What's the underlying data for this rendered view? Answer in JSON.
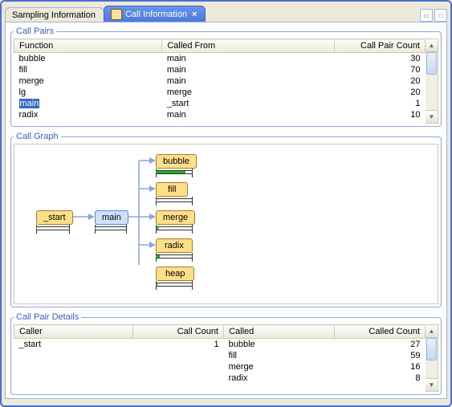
{
  "tabs": {
    "inactive": "Sampling Information",
    "active": "Call Information"
  },
  "call_pairs": {
    "title": "Call Pairs",
    "headers": {
      "function": "Function",
      "called_from": "Called From",
      "count": "Call Pair Count"
    },
    "rows": [
      {
        "fn": "bubble",
        "from": "main",
        "count": "30",
        "sel": false
      },
      {
        "fn": "fill",
        "from": "main",
        "count": "70",
        "sel": false
      },
      {
        "fn": "merge",
        "from": "main",
        "count": "20",
        "sel": false
      },
      {
        "fn": "lg",
        "from": "merge",
        "count": "20",
        "sel": false
      },
      {
        "fn": "main",
        "from": "_start",
        "count": "1",
        "sel": true
      },
      {
        "fn": "radix",
        "from": "main",
        "count": "10",
        "sel": false
      }
    ]
  },
  "call_graph": {
    "title": "Call Graph",
    "nodes": {
      "start": "_start",
      "main": "main",
      "bubble": "bubble",
      "fill": "fill",
      "merge": "merge",
      "radix": "radix",
      "heap": "heap"
    }
  },
  "call_pair_details": {
    "title": "Call Pair Details",
    "headers": {
      "caller": "Caller",
      "call_count": "Call Count",
      "called": "Called",
      "called_count": "Called Count"
    },
    "caller": "_start",
    "call_count": "1",
    "rows": [
      {
        "called": "bubble",
        "count": "27"
      },
      {
        "called": "fill",
        "count": "59"
      },
      {
        "called": "merge",
        "count": "16"
      },
      {
        "called": "radix",
        "count": "8"
      }
    ]
  }
}
